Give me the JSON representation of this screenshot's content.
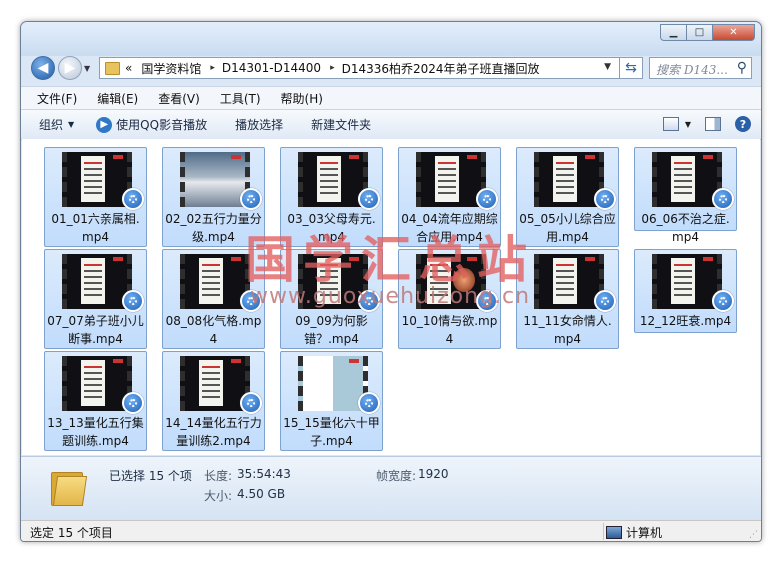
{
  "window": {
    "controls": {
      "minimize": "▁",
      "maximize": "□",
      "close": "✕"
    }
  },
  "nav": {
    "back": "◀",
    "forward": "▶",
    "history_dropdown": "▼",
    "breadcrumb_lead": "«",
    "breadcrumbs": [
      "国学资料馆",
      "D14301-D14400",
      "D14336柏乔2024年弟子班直播回放"
    ],
    "separator": "▸",
    "address_dropdown": "▼",
    "refresh": "⇆",
    "search_placeholder": "搜索 D143...",
    "search_icon": "⚲"
  },
  "menu": [
    "文件(F)",
    "编辑(E)",
    "查看(V)",
    "工具(T)",
    "帮助(H)"
  ],
  "toolbar": {
    "organize": "组织",
    "play_with_qq": "使用QQ影音播放",
    "play_selection": "播放选择",
    "new_folder": "新建文件夹",
    "dropdown_arrow": "▼",
    "help": "?"
  },
  "files": [
    {
      "name": "01_01六亲属相.mp4",
      "thumb": "doc"
    },
    {
      "name": "02_02五行力量分级.mp4",
      "thumb": "sky"
    },
    {
      "name": "03_03父母寿元.mp4",
      "thumb": "doc"
    },
    {
      "name": "04_04流年应期综合应用.mp4",
      "thumb": "doc"
    },
    {
      "name": "05_05小儿综合应用.mp4",
      "thumb": "doc"
    },
    {
      "name": "06_06不治之症.mp4",
      "thumb": "doc"
    },
    {
      "name": "07_07弟子班小儿断事.mp4",
      "thumb": "doc"
    },
    {
      "name": "08_08化气格.mp4",
      "thumb": "doc"
    },
    {
      "name": "09_09为何影错？.mp4",
      "thumb": "doc"
    },
    {
      "name": "10_10情与欲.mp4",
      "thumb": "photo"
    },
    {
      "name": "11_11女命情人.mp4",
      "thumb": "doc"
    },
    {
      "name": "12_12旺衰.mp4",
      "thumb": "doc"
    },
    {
      "name": "13_13量化五行集题训练.mp4",
      "thumb": "doc"
    },
    {
      "name": "14_14量化五行力量训练2.mp4",
      "thumb": "doc"
    },
    {
      "name": "15_15量化六十甲子.mp4",
      "thumb": "split"
    }
  ],
  "details": {
    "selected": "已选择 15 个项",
    "length_label": "长度:",
    "length_value": "35:54:43",
    "size_label": "大小:",
    "size_value": "4.50 GB",
    "frame_width_label": "帧宽度:",
    "frame_width_value": "1920"
  },
  "status": {
    "text": "选定 15 个项目",
    "computer": "计算机",
    "grip": "⋰"
  },
  "watermark": {
    "cn": "国学汇总站",
    "url": "www.guoxuehuizong.cn"
  }
}
